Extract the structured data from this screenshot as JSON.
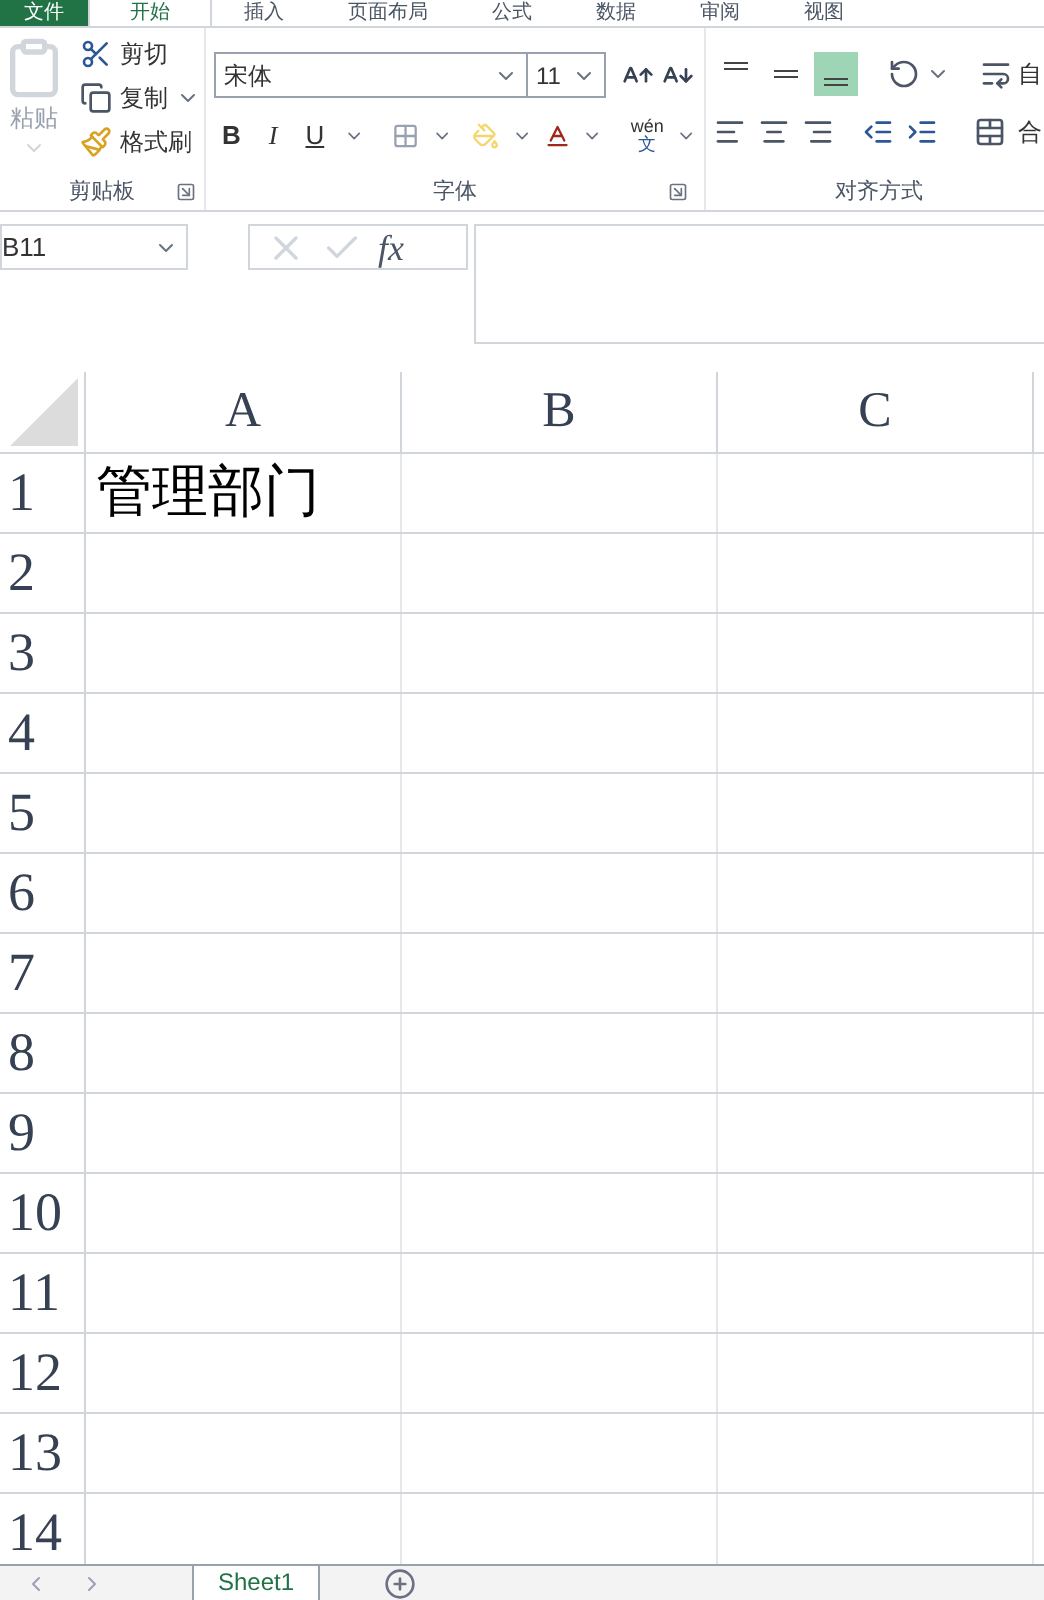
{
  "file_menu": "文件",
  "ribbon_tabs": [
    {
      "label": "开始",
      "selected": true
    },
    {
      "label": "插入",
      "selected": false
    },
    {
      "label": "页面布局",
      "selected": false
    },
    {
      "label": "公式",
      "selected": false
    },
    {
      "label": "数据",
      "selected": false
    },
    {
      "label": "审阅",
      "selected": false
    },
    {
      "label": "视图",
      "selected": false
    }
  ],
  "clipboard": {
    "paste": "粘贴",
    "cut": "剪切",
    "copy": "复制",
    "format_painter": "格式刷",
    "group_label": "剪贴板"
  },
  "font": {
    "name": "宋体",
    "size": "11",
    "bold": "B",
    "italic": "I",
    "underline": "U",
    "phonetic_top": "wén",
    "phonetic_bottom": "文",
    "group_label": "字体"
  },
  "alignment": {
    "vertical": [
      {
        "selected": false
      },
      {
        "selected": false
      },
      {
        "selected": true
      }
    ],
    "wrap_text": "自",
    "merge": "合",
    "group_label": "对齐方式"
  },
  "name_box": "B11",
  "formula_bar": {
    "fx": "fx"
  },
  "columns": [
    "A",
    "B",
    "C"
  ],
  "rows": [
    {
      "header": "1",
      "a": "管理部门"
    },
    {
      "header": "2"
    },
    {
      "header": "3"
    },
    {
      "header": "4"
    },
    {
      "header": "5"
    },
    {
      "header": "6"
    },
    {
      "header": "7"
    },
    {
      "header": "8"
    },
    {
      "header": "9"
    },
    {
      "header": "10"
    },
    {
      "header": "11"
    },
    {
      "header": "12"
    },
    {
      "header": "13"
    },
    {
      "header": "14"
    }
  ],
  "sheets": [
    {
      "label": "Sheet1",
      "selected": true
    }
  ]
}
